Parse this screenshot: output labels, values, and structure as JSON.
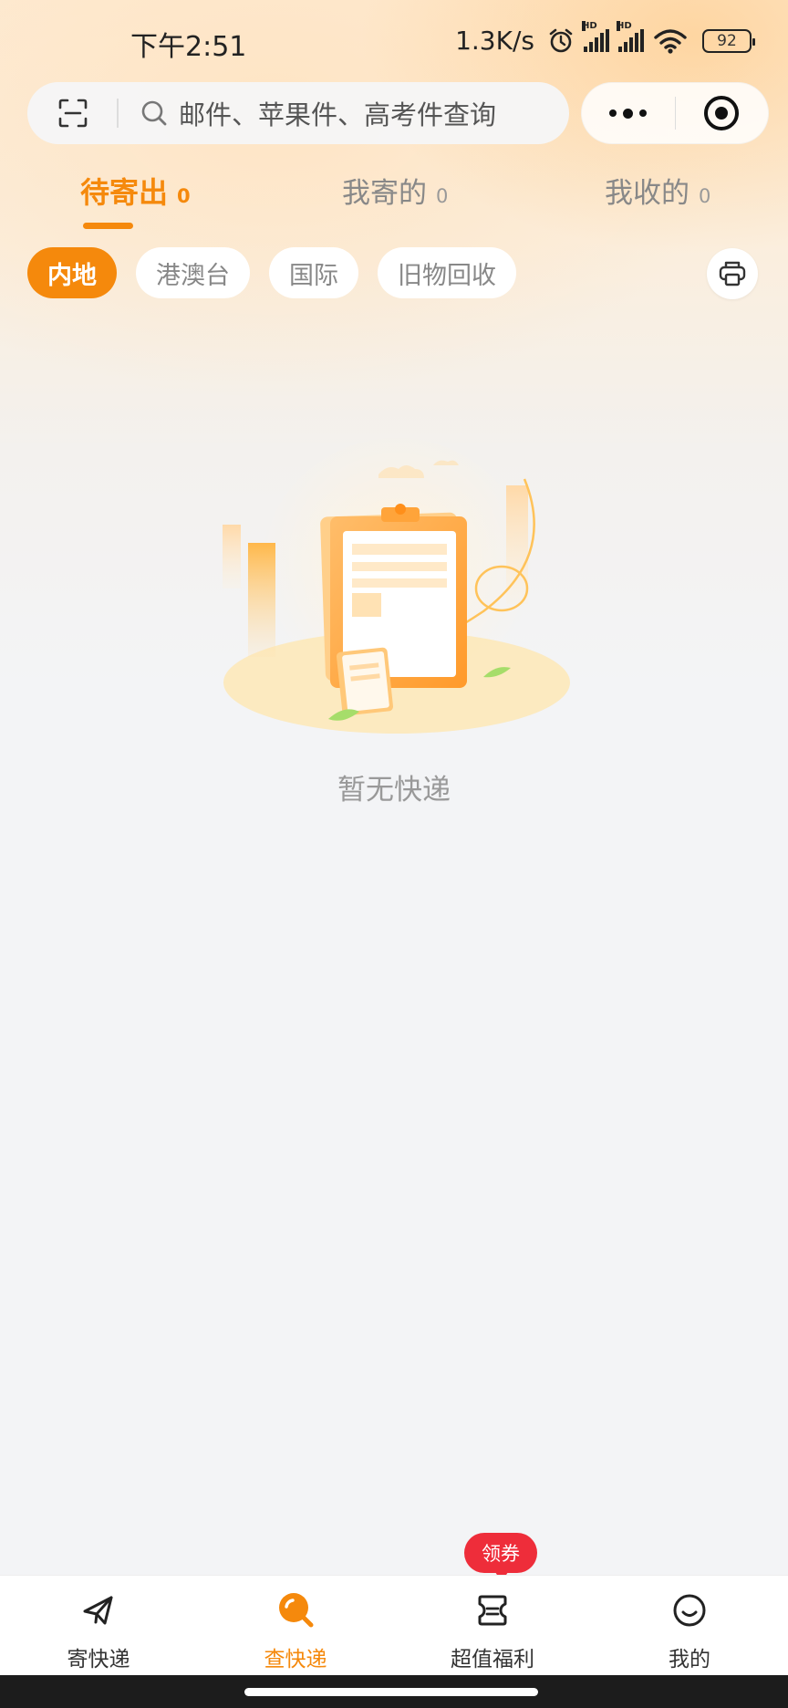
{
  "status_bar": {
    "time": "下午2:51",
    "net_speed": "1.3K/s",
    "signal_label": "HD",
    "battery": "92"
  },
  "search": {
    "placeholder": "邮件、苹果件、高考件查询"
  },
  "tabs": [
    {
      "label": "待寄出",
      "count": "0",
      "active": true
    },
    {
      "label": "我寄的",
      "count": "0",
      "active": false
    },
    {
      "label": "我收的",
      "count": "0",
      "active": false
    }
  ],
  "regions": [
    {
      "label": "内地",
      "active": true
    },
    {
      "label": "港澳台",
      "active": false
    },
    {
      "label": "国际",
      "active": false
    },
    {
      "label": "旧物回收",
      "active": false
    }
  ],
  "empty_state": {
    "message": "暂无快递"
  },
  "bottom_nav": [
    {
      "label": "寄快递",
      "icon": "paper-plane-icon",
      "active": false
    },
    {
      "label": "查快递",
      "icon": "magnifier-icon",
      "active": true
    },
    {
      "label": "超值福利",
      "icon": "ticket-icon",
      "active": false
    },
    {
      "label": "我的",
      "icon": "smile-icon",
      "active": false
    }
  ],
  "coupon_badge": "领券",
  "colors": {
    "accent": "#f5890c",
    "badge": "#ee2d3a",
    "background": "#f3f4f6"
  }
}
